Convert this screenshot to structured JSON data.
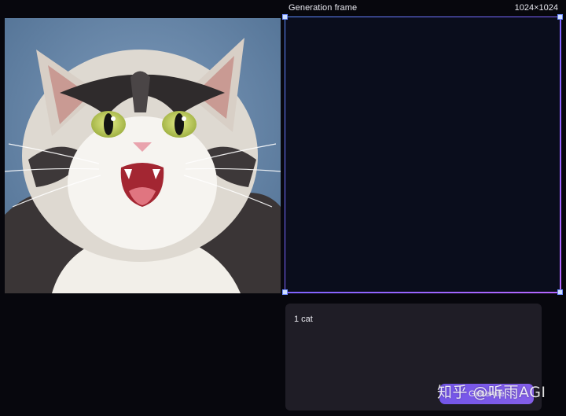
{
  "generation_frame": {
    "title": "Generation frame",
    "size": "1024×1024"
  },
  "prompt": {
    "text": "1 cat",
    "generate_label": "Generate"
  },
  "watermark": {
    "text": "知乎 @听雨AGI"
  },
  "colors": {
    "background": "#07070d",
    "frame_fill": "#0a0d1c",
    "frame_border_start": "#5b8dff",
    "frame_border_end": "#b766ff",
    "prompt_panel": "#1f1d26",
    "accent": "#7d5cff"
  }
}
